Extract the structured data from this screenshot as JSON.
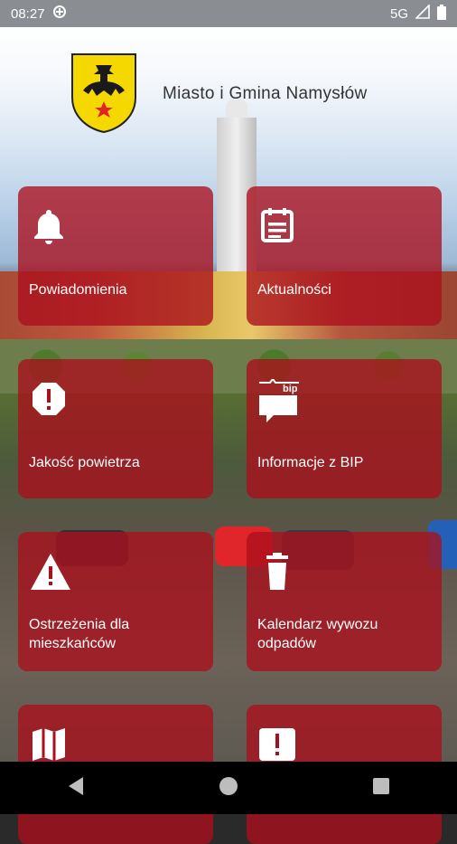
{
  "status_bar": {
    "time": "08:27",
    "network": "5G",
    "icons": [
      "data-saver-icon",
      "signal-icon",
      "battery-icon"
    ]
  },
  "header": {
    "title": "Miasto i Gmina Namysłów",
    "logo": "coat-of-arms-logo"
  },
  "tiles": [
    {
      "label": "Powiadomienia",
      "icon": "bell-icon"
    },
    {
      "label": "Aktualności",
      "icon": "newspaper-icon"
    },
    {
      "label": "Jakość powietrza",
      "icon": "alert-octagon-icon"
    },
    {
      "label": "Informacje z BIP",
      "icon": "bip-icon",
      "icon_text": "bip"
    },
    {
      "label": "Ostrzeżenia dla mieszkańców",
      "icon": "warning-triangle-icon"
    },
    {
      "label": "Kalendarz wywozu odpadów",
      "icon": "trash-icon"
    },
    {
      "label": "",
      "icon": "map-icon"
    },
    {
      "label": "",
      "icon": "report-alert-icon"
    }
  ],
  "nav_bar": {
    "buttons": [
      "back-button",
      "home-button",
      "recents-button"
    ]
  },
  "colors": {
    "tile_background": "#aa0f1c",
    "status_bar": "#8a8d91",
    "coat_yellow": "#f5d800",
    "coat_star": "#e4202a"
  }
}
